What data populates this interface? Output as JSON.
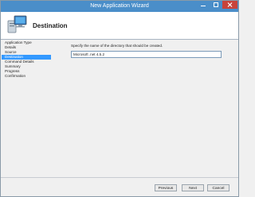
{
  "window": {
    "title": "New Application Wizard"
  },
  "header": {
    "heading": "Destination",
    "icon": "wizard-computer-icon"
  },
  "sidebar": {
    "steps": [
      {
        "label": "Application Type"
      },
      {
        "label": "Details"
      },
      {
        "label": "Source"
      },
      {
        "label": "Destination",
        "active": true
      },
      {
        "label": "Command Details"
      },
      {
        "label": "Summary"
      },
      {
        "label": "Progress"
      },
      {
        "label": "Confirmation"
      }
    ]
  },
  "content": {
    "prompt": "Specify the name of the directory that should be created.",
    "directory_value": "Microsoft .net 4.5.2"
  },
  "footer": {
    "previous_label": "Previous",
    "next_label": "Next",
    "cancel_label": "Cancel"
  },
  "colors": {
    "titlebar": "#4a8ec9",
    "active_step": "#3399ff",
    "close_button": "#c8433a"
  }
}
